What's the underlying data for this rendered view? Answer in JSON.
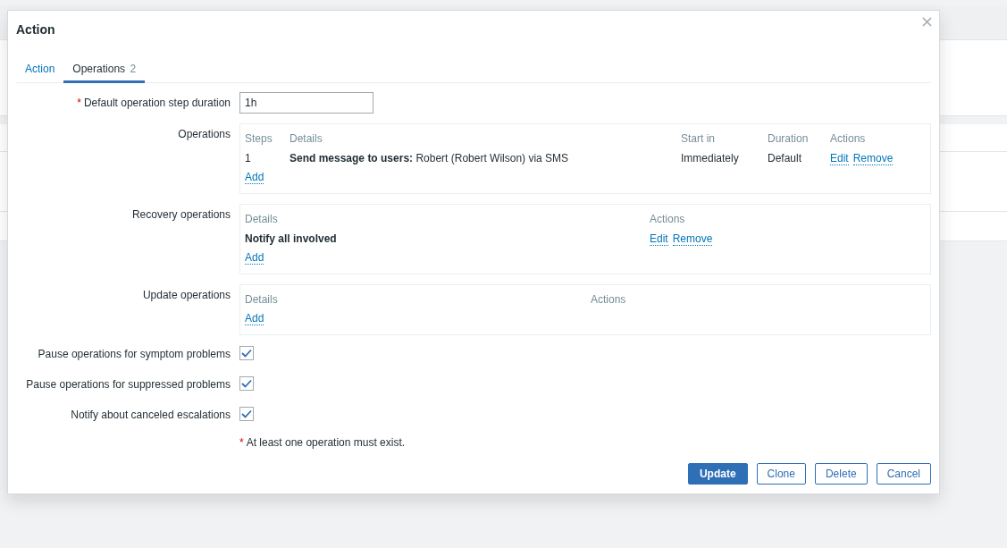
{
  "dialog": {
    "title": "Action",
    "tabs": [
      {
        "label": "Action",
        "selected": false
      },
      {
        "label": "Operations",
        "count": "2",
        "selected": true
      }
    ],
    "step_duration": {
      "label": "Default operation step duration",
      "required": true,
      "value": "1h"
    },
    "operation_tables": [
      {
        "label": "Operations",
        "columns": [
          "Steps",
          "Details",
          "Start in",
          "Duration",
          "Actions"
        ],
        "rows": [
          {
            "cells": [
              {
                "kind": "text",
                "text": "1"
              },
              {
                "kind": "text",
                "text": "**Send message to users:** Robert (Robert Wilson) via SMS"
              },
              {
                "kind": "text",
                "text": "Immediately"
              },
              {
                "kind": "text",
                "text": "Default"
              },
              {
                "kind": "links",
                "links": [
                  "Edit",
                  "Remove"
                ]
              }
            ]
          }
        ],
        "add_link": "Add"
      },
      {
        "label": "Recovery operations",
        "columns": [
          "Details",
          "Actions"
        ],
        "rows": [
          {
            "cells": [
              {
                "kind": "strong",
                "text": "Notify all involved"
              },
              {
                "kind": "links",
                "links": [
                  "Edit",
                  "Remove"
                ]
              }
            ]
          }
        ],
        "add_link": "Add"
      },
      {
        "label": "Update operations",
        "columns": [
          "Details",
          "Actions"
        ],
        "add_link": "Add"
      }
    ],
    "checkboxes": [
      {
        "label": "Pause operations for symptom problems",
        "checked": true
      },
      {
        "label": "Pause operations for suppressed problems",
        "checked": true
      },
      {
        "label": "Notify about canceled escalations",
        "checked": true
      }
    ],
    "note": {
      "marker": "*",
      "text": "At least one operation must exist."
    },
    "buttons": [
      {
        "label": "Update",
        "primary": true
      },
      {
        "label": "Clone",
        "primary": false
      },
      {
        "label": "Delete",
        "primary": false
      },
      {
        "label": "Cancel",
        "primary": false
      }
    ]
  }
}
